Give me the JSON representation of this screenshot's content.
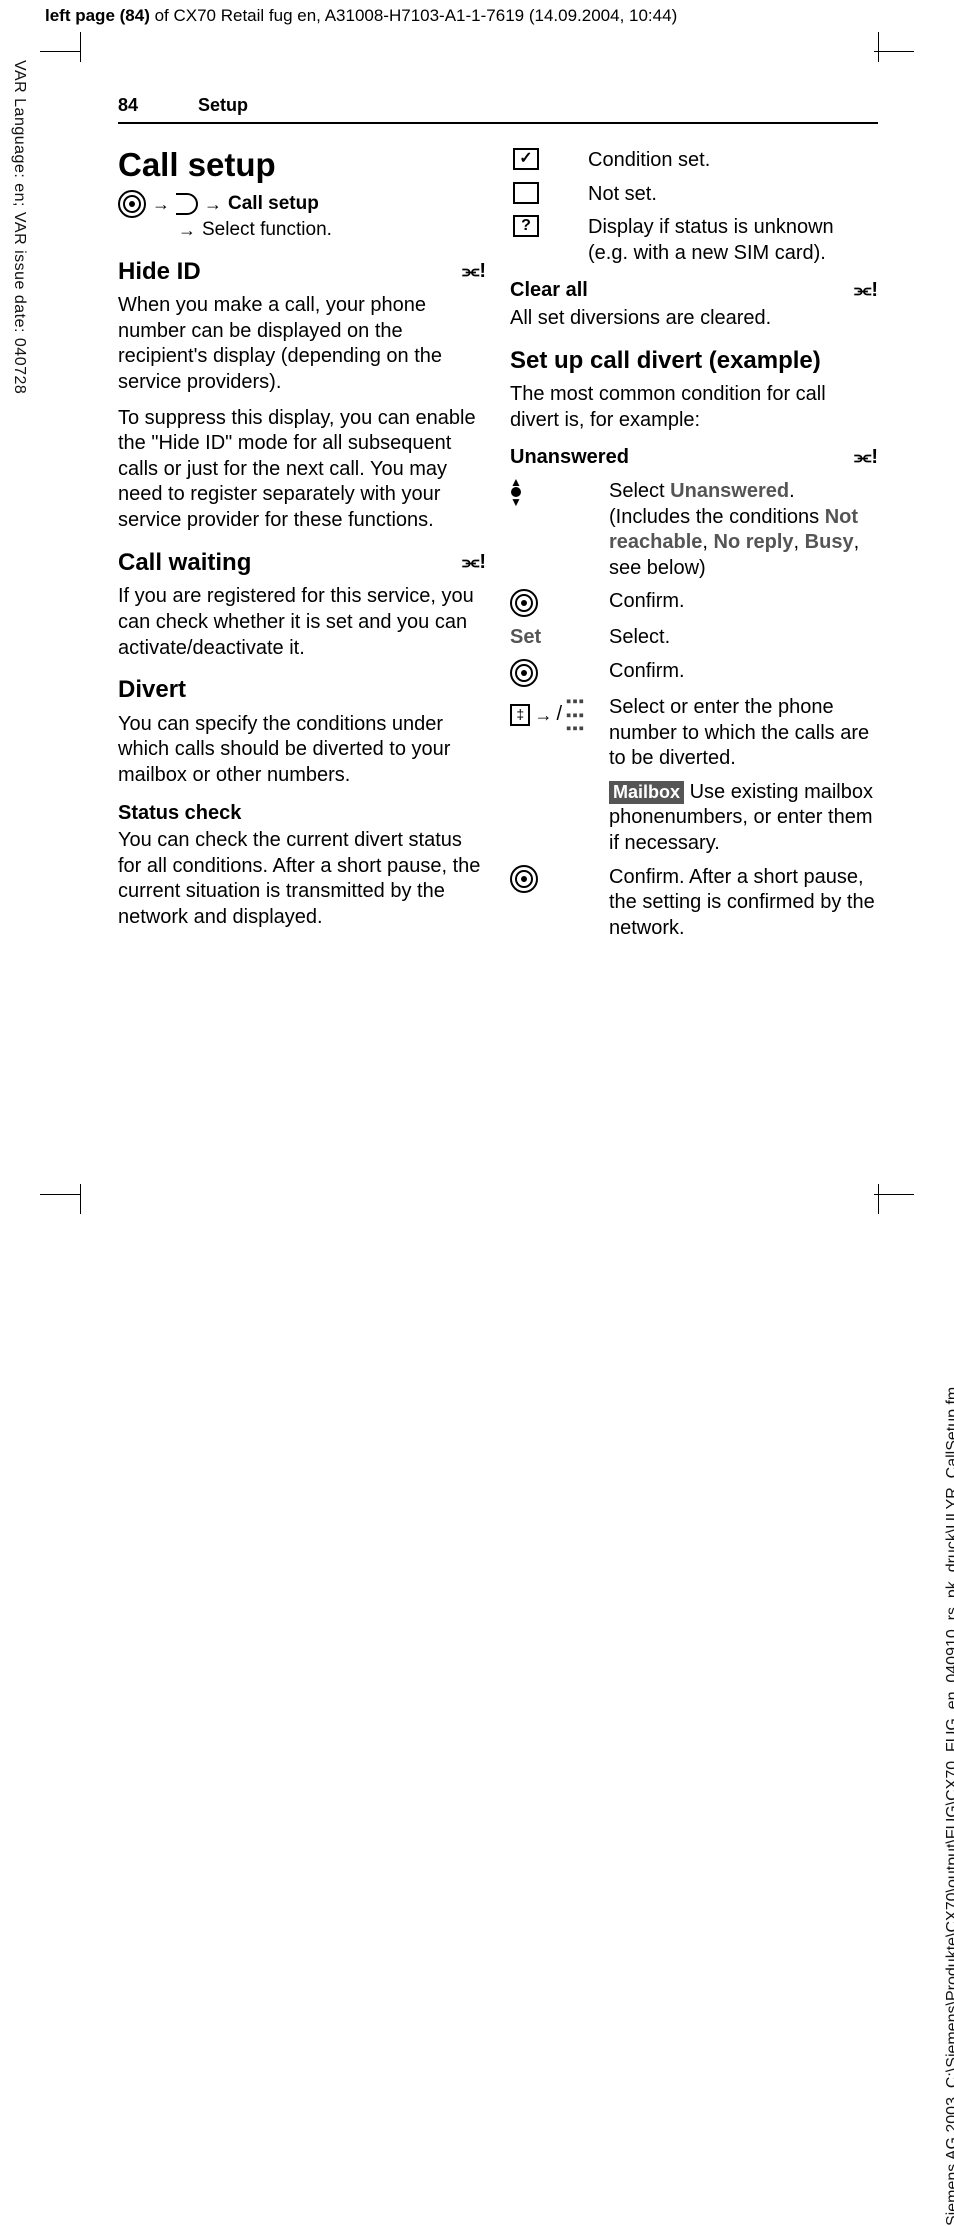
{
  "meta": {
    "top_line_bold": "left page (84)",
    "top_line_rest": " of CX70 Retail fug en, A31008-H7103-A1-1-7619 (14.09.2004, 10:44)",
    "side_left": "VAR Language: en; VAR issue date: 040728",
    "side_right": "Siemens AG 2003, C:\\Siemens\\Produkte\\CX70\\output\\FUG\\CX70_FUG_en_040910_rs_pk_druck\\ULYR_CallSetup.fm"
  },
  "header": {
    "page_number": "84",
    "section": "Setup"
  },
  "left": {
    "h1": "Call setup",
    "nav_label": "Call setup",
    "nav_sub": "Select function.",
    "hide_id_h": "Hide ID",
    "hide_id_p1": "When you make a call, your phone number can be displayed on the recipient's display (depending on the service providers).",
    "hide_id_p2": "To suppress this display, you can enable the \"Hide ID\" mode for all subsequent calls or just for the next call. You may need to register separately with your service provider for these functions.",
    "callwait_h": "Call waiting",
    "callwait_p": "If you are registered for this service, you can check whether it is set and you can activate/deactivate it.",
    "divert_h": "Divert",
    "divert_p": "You can specify the conditions under which calls should be diverted to your mailbox or other numbers.",
    "status_h": "Status check",
    "status_p": "You can check the current divert status for all conditions. After a short pause, the current situation is transmitted by the network and displayed."
  },
  "right": {
    "r1": "Condition set.",
    "r2": "Not set.",
    "r3": "Display if status is unknown (e.g. with a new SIM card).",
    "clear_h": "Clear all",
    "clear_p": "All set diversions are cleared.",
    "setup_h": "Set up call divert (example)",
    "setup_p": "The most common condition for call divert is, for example:",
    "unans_h": "Unanswered",
    "step1_a": "Select ",
    "step1_b": "Unanswered",
    "step1_c": ". (Includes the conditions ",
    "step1_d": "Not reachable",
    "step1_e": ", ",
    "step1_f": "No reply",
    "step1_g": ", ",
    "step1_h": "Busy",
    "step1_i": ", see below)",
    "step2": "Confirm.",
    "set_label": "Set",
    "step3": "Select.",
    "step4": "Confirm.",
    "step5": "Select or enter the phone number to which the calls are to be diverted.",
    "mailbox_label": "Mailbox",
    "step6": " Use existing mailbox phonenumbers, or enter them if necessary.",
    "step7": "Confirm. After a short pause, the setting is confirmed by the network."
  }
}
